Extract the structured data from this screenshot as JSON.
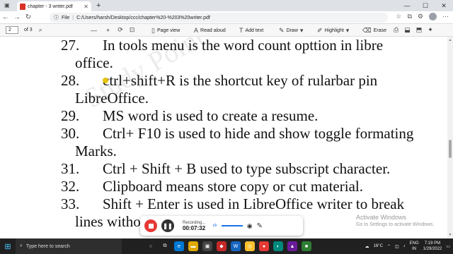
{
  "browser": {
    "tab_title": "chapter - 3 writer.pdf",
    "tab_close": "✕",
    "new_tab": "+",
    "file_label": "File",
    "url": "C:/Users/harsh/Desktop/ccc/chapter%20-%203%20writer.pdf",
    "window_controls": [
      "—",
      "☐",
      "✕"
    ]
  },
  "pdf_toolbar": {
    "page_current": "2",
    "page_total": "of 3",
    "zoom_out": "—",
    "zoom_in": "+",
    "page_view": "Page view",
    "read_aloud": "Read aloud",
    "add_text": "Add text",
    "draw": "Draw",
    "highlight": "Highlight",
    "erase": "Erase"
  },
  "document": {
    "lines": [
      {
        "num": "27.",
        "text": "In tools menu is the word count opttion in libre"
      },
      {
        "num": "",
        "text": "office."
      },
      {
        "num": "28.",
        "text": "ctrl+shift+R is the shortcut key of rularbar pin"
      },
      {
        "num": "",
        "text": "LibreOffice."
      },
      {
        "num": "29.",
        "text": "MS word is used to create a resume."
      },
      {
        "num": "30.",
        "text": "Ctrl+ F10 is used to hide and show toggle formating"
      },
      {
        "num": "",
        "text": "Marks."
      },
      {
        "num": "31.",
        "text": "Ctrl + Shift + B used to type subscript character."
      },
      {
        "num": "32.",
        "text": "Clipboard means store copy or cut material."
      },
      {
        "num": "33.",
        "text": "Shift + Enter is used in LibreOffice writer to break"
      },
      {
        "num": "",
        "text": "lines witho"
      }
    ]
  },
  "activate_windows": {
    "title": "Activate Windows",
    "subtitle": "Go to Settings to activate Windows."
  },
  "recorder": {
    "label": "Recording...",
    "time": "00:07:32"
  },
  "taskbar": {
    "search_placeholder": "Type here to search",
    "weather": "16°C",
    "lang_line1": "ENG",
    "lang_line2": "IN",
    "time": "7:19 PM",
    "date": "1/29/2022"
  },
  "colors": {
    "record_button": "#e53935",
    "taskbar": "#202020",
    "accent": "#1a73e8"
  }
}
